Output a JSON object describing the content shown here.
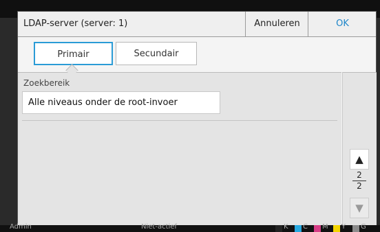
{
  "dialog": {
    "title": "LDAP-server (server: 1)",
    "cancel_label": "Annuleren",
    "ok_label": "OK",
    "tabs": [
      {
        "label": "Primair",
        "selected": true
      },
      {
        "label": "Secundair",
        "selected": false
      }
    ],
    "field_label": "Zoekbereik",
    "field_value": "Alle niveaus onder de root-invoer",
    "pager": {
      "current": "2",
      "total": "2"
    }
  },
  "statusbar": {
    "user": "Admin",
    "status": "Niet-actief",
    "inks": [
      "K",
      "C",
      "M",
      "Y",
      "G"
    ],
    "ink_colors": [
      "#222222",
      "#28a9e0",
      "#d63d86",
      "#f2d400",
      "#8c8c8c"
    ]
  },
  "accent": "#1e86c9"
}
